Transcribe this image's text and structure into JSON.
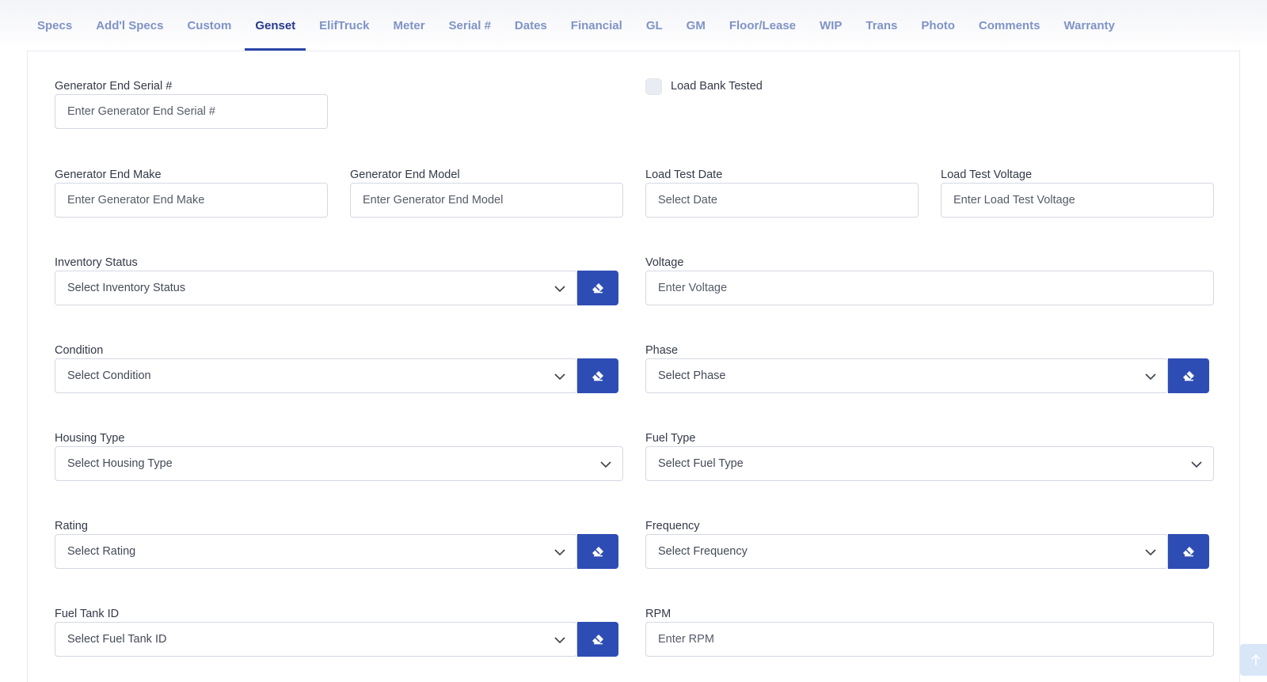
{
  "tabs": [
    "Specs",
    "Add'l Specs",
    "Custom",
    "Genset",
    "ElifTruck",
    "Meter",
    "Serial #",
    "Dates",
    "Financial",
    "GL",
    "GM",
    "Floor/Lease",
    "WIP",
    "Trans",
    "Photo",
    "Comments",
    "Warranty"
  ],
  "active_tab": "Genset",
  "colors": {
    "accent": "#2e4db4",
    "tab_inactive": "#7f93c6",
    "tab_active": "#24398e"
  },
  "icons": {
    "clear": "eraser-icon",
    "dropdown": "chevron-down-icon",
    "scroll_top": "arrow-up-icon"
  },
  "form": {
    "gen_end_serial": {
      "label": "Generator End Serial #",
      "placeholder": "Enter Generator End Serial #"
    },
    "load_bank_tested": {
      "label": "Load Bank Tested",
      "checked": false
    },
    "gen_end_make": {
      "label": "Generator End Make",
      "placeholder": "Enter Generator End Make"
    },
    "gen_end_model": {
      "label": "Generator End Model",
      "placeholder": "Enter Generator End Model"
    },
    "load_test_date": {
      "label": "Load Test Date",
      "placeholder": "Select Date"
    },
    "load_test_voltage": {
      "label": "Load Test Voltage",
      "placeholder": "Enter Load Test Voltage"
    },
    "inventory_status": {
      "label": "Inventory Status",
      "value": "Select Inventory Status"
    },
    "voltage": {
      "label": "Voltage",
      "placeholder": "Enter Voltage"
    },
    "condition": {
      "label": "Condition",
      "value": "Select Condition"
    },
    "phase": {
      "label": "Phase",
      "value": "Select Phase"
    },
    "housing_type": {
      "label": "Housing Type",
      "value": "Select Housing Type"
    },
    "fuel_type": {
      "label": "Fuel Type",
      "value": "Select Fuel Type"
    },
    "rating": {
      "label": "Rating",
      "value": "Select Rating"
    },
    "frequency": {
      "label": "Frequency",
      "value": "Select Frequency"
    },
    "fuel_tank_id": {
      "label": "Fuel Tank ID",
      "value": "Select Fuel Tank ID"
    },
    "rpm": {
      "label": "RPM",
      "placeholder": "Enter RPM"
    }
  }
}
